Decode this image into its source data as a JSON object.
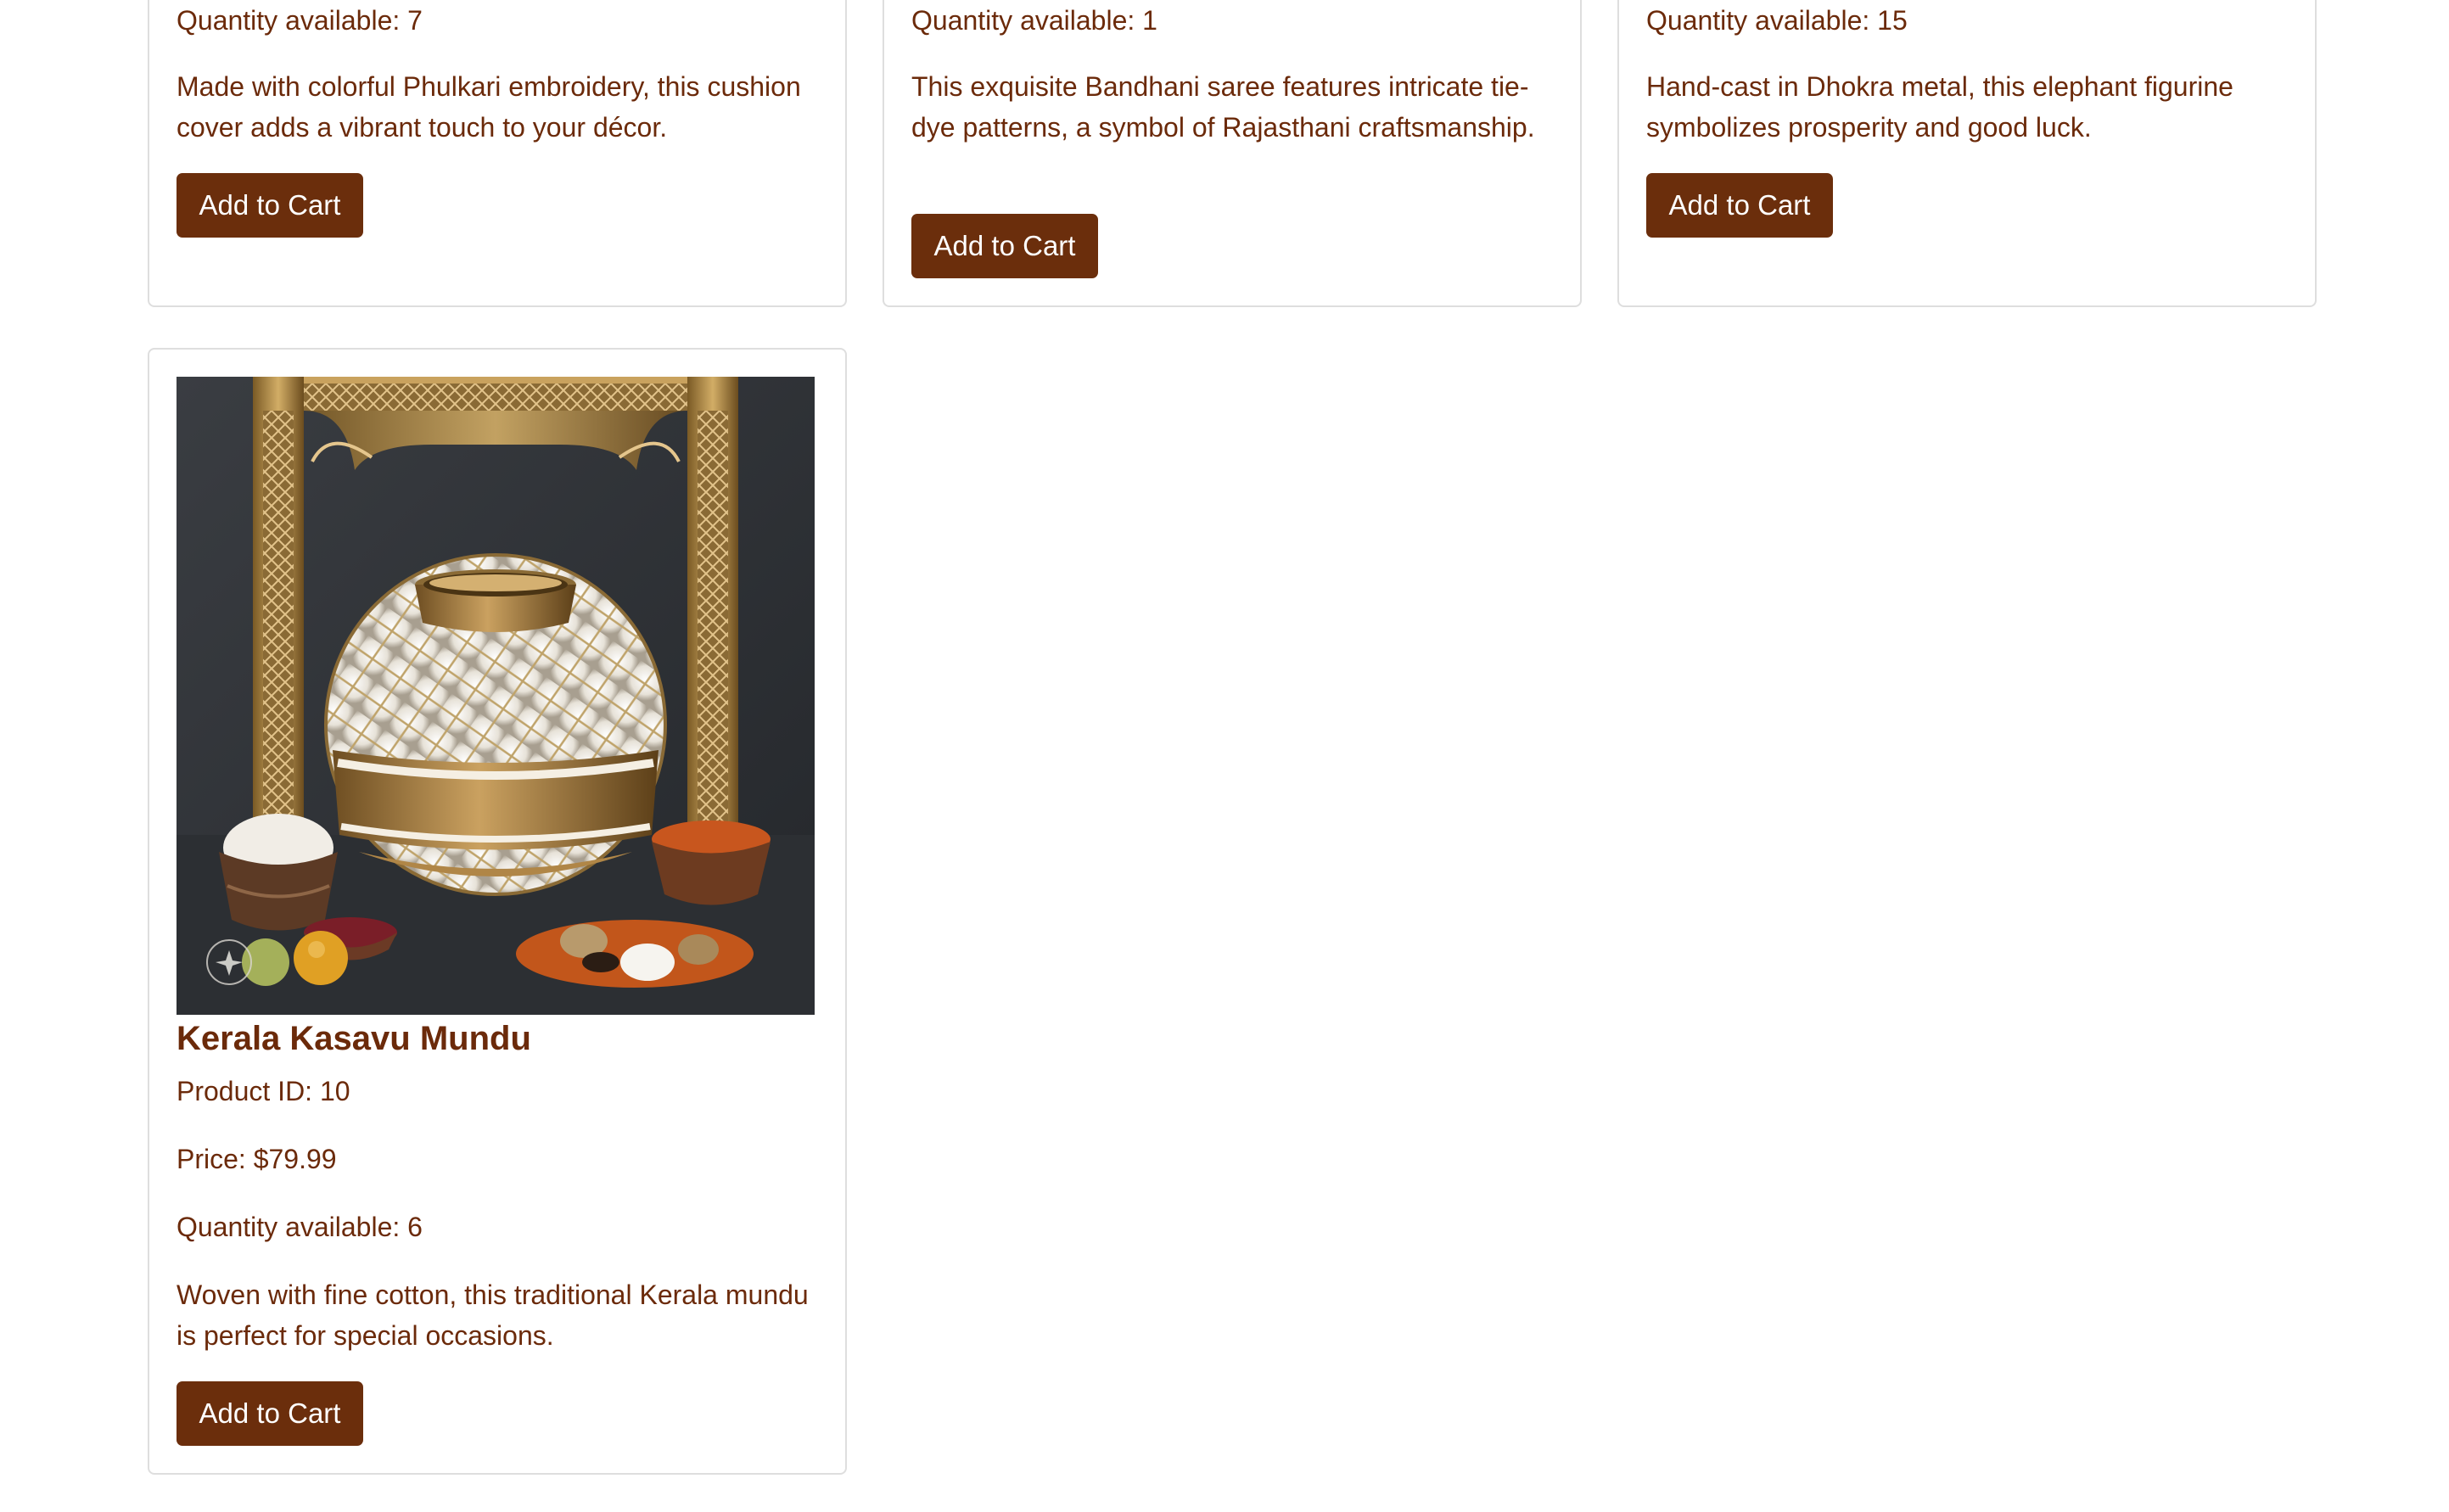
{
  "colors": {
    "text": "#6b2a0a",
    "button_bg": "#6b2e0c",
    "button_text": "#ffffff",
    "card_border": "#dedede",
    "page_bg": "#ffffff"
  },
  "products": [
    {
      "quantity_text": "Quantity available: 7",
      "description": "Made with colorful Phulkari embroidery, this cushion cover adds a vibrant touch to your décor.",
      "button_label": "Add to Cart"
    },
    {
      "quantity_text": "Quantity available: 1",
      "description": "This exquisite Bandhani saree features intricate tie-dye patterns, a symbol of Rajasthani craftsmanship.",
      "button_label": "Add to Cart"
    },
    {
      "quantity_text": "Quantity available: 15",
      "description": "Hand-cast in Dhokra metal, this elephant figurine symbolizes prosperity and good luck.",
      "button_label": "Add to Cart"
    },
    {
      "image_icon": "product-image-decorative-pot",
      "name": "Kerala Kasavu Mundu",
      "id_text": "Product ID: 10",
      "price_text": "Price: $79.99",
      "quantity_text": "Quantity available: 6",
      "description": "Woven with fine cotton, this traditional Kerala mundu is perfect for special occasions.",
      "button_label": "Add to Cart"
    }
  ]
}
